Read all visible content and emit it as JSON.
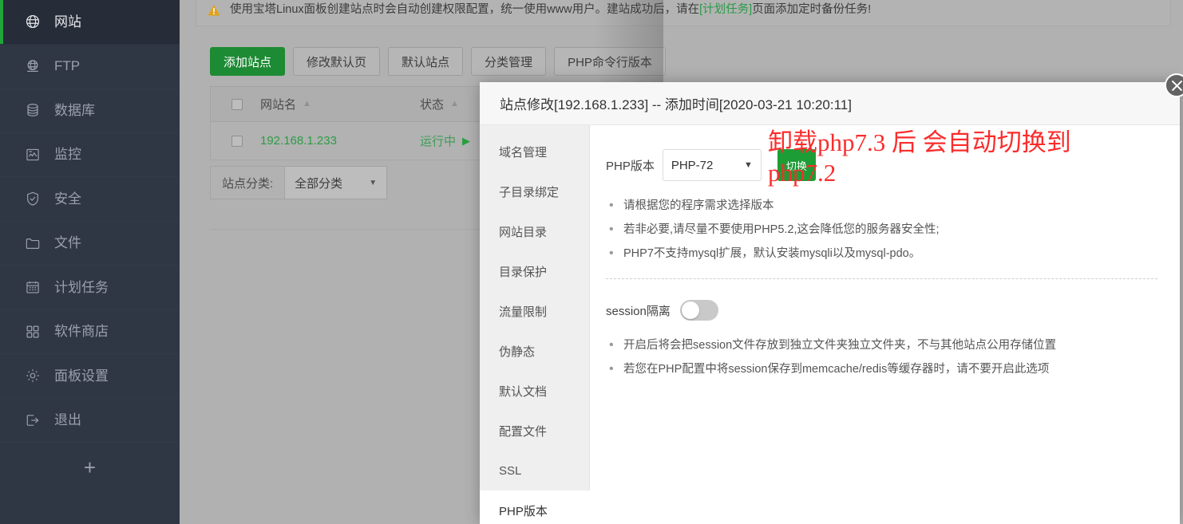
{
  "sidebar": {
    "items": [
      {
        "label": "网站",
        "icon": "globe-icon",
        "active": true
      },
      {
        "label": "FTP",
        "icon": "ftp-globe-icon",
        "active": false
      },
      {
        "label": "数据库",
        "icon": "database-icon",
        "active": false
      },
      {
        "label": "监控",
        "icon": "monitor-chart-icon",
        "active": false
      },
      {
        "label": "安全",
        "icon": "shield-check-icon",
        "active": false
      },
      {
        "label": "文件",
        "icon": "folder-icon",
        "active": false
      },
      {
        "label": "计划任务",
        "icon": "calendar-icon",
        "active": false
      },
      {
        "label": "软件商店",
        "icon": "grid-apps-icon",
        "active": false
      },
      {
        "label": "面板设置",
        "icon": "gear-icon",
        "active": false
      },
      {
        "label": "退出",
        "icon": "logout-icon",
        "active": false
      }
    ],
    "add_label": "+"
  },
  "notice": {
    "icon": "warning-triangle-icon",
    "text_before": "使用宝塔Linux面板创建站点时会自动创建权限配置，统一使用www用户。建站成功后，请在",
    "link": "[计划任务]",
    "text_after": "页面添加定时备份任务!"
  },
  "toolbar": {
    "buttons": [
      {
        "label": "添加站点",
        "primary": true
      },
      {
        "label": "修改默认页",
        "primary": false
      },
      {
        "label": "默认站点",
        "primary": false
      },
      {
        "label": "分类管理",
        "primary": false
      },
      {
        "label": "PHP命令行版本",
        "primary": false
      }
    ]
  },
  "table": {
    "headers": {
      "name": "网站名",
      "status": "状态",
      "sort_icon": "sort-asc-icon"
    },
    "rows": [
      {
        "name": "192.168.1.233",
        "status": "运行中",
        "status_icon": "play-icon"
      }
    ]
  },
  "filter": {
    "label": "站点分类:",
    "value": "全部分类",
    "caret": "▼"
  },
  "dialog": {
    "title": "站点修改[192.168.1.233] -- 添加时间[2020-03-21 10:20:11]",
    "close_icon": "close-icon",
    "tabs": [
      {
        "label": "域名管理",
        "active": false
      },
      {
        "label": "子目录绑定",
        "active": false
      },
      {
        "label": "网站目录",
        "active": false
      },
      {
        "label": "目录保护",
        "active": false
      },
      {
        "label": "流量限制",
        "active": false
      },
      {
        "label": "伪静态",
        "active": false
      },
      {
        "label": "默认文档",
        "active": false
      },
      {
        "label": "配置文件",
        "active": false
      },
      {
        "label": "SSL",
        "active": false
      },
      {
        "label": "PHP版本",
        "active": true
      }
    ],
    "php": {
      "label": "PHP版本",
      "selected": "PHP-72",
      "caret": "▼",
      "switch_label": "切换"
    },
    "php_tips": [
      "请根据您的程序需求选择版本",
      "若非必要,请尽量不要使用PHP5.2,这会降低您的服务器安全性;",
      "PHP7不支持mysql扩展，默认安装mysqli以及mysql-pdo。"
    ],
    "session": {
      "label": "session隔离",
      "enabled": false
    },
    "session_tips": [
      "开启后将会把session文件存放到独立文件夹独立文件夹，不与其他站点公用存储位置",
      "若您在PHP配置中将session保存到memcache/redis等缓存器时，请不要开启此选项"
    ]
  },
  "annotation": {
    "text": "卸载php7.3 后 会自动切换到\nphp7.2",
    "color": "#fb2c2c"
  }
}
